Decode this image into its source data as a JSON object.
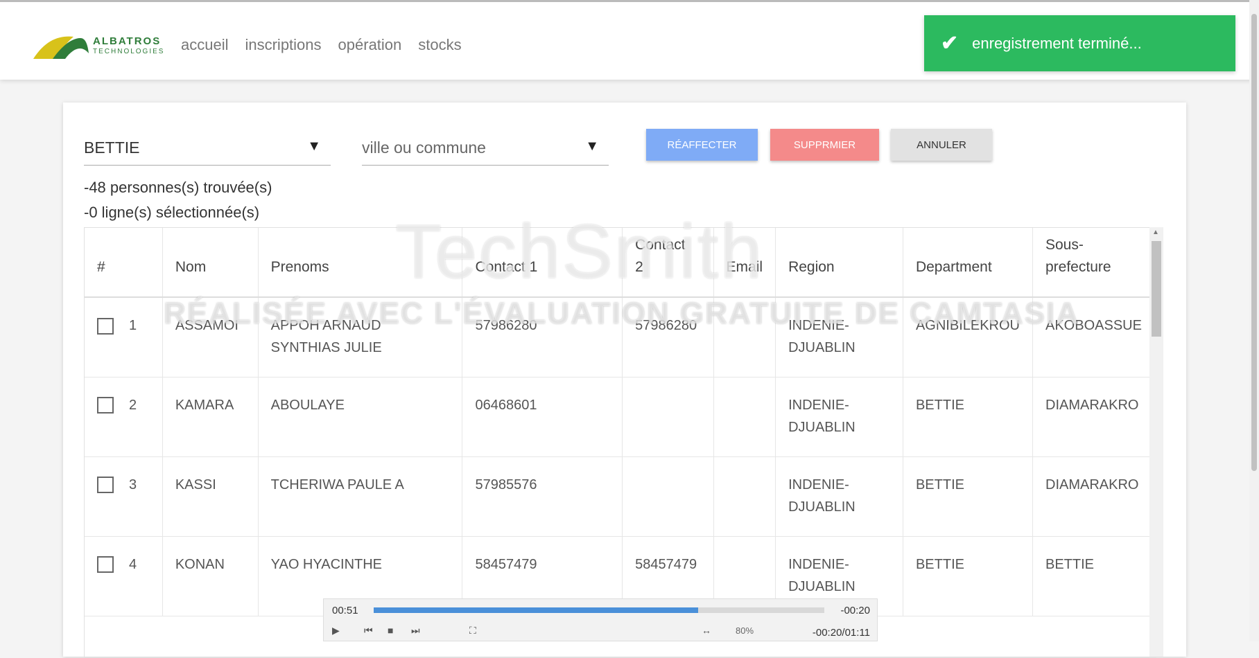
{
  "header": {
    "brand_line1": "ALBATROS",
    "brand_line2": "TECHNOLOGIES",
    "nav": [
      "accueil",
      "inscriptions",
      "opération",
      "stocks"
    ]
  },
  "toast": {
    "message": "enregistrement terminé..."
  },
  "filters": {
    "department_value": "BETTIE",
    "commune_placeholder": "ville ou commune"
  },
  "buttons": {
    "reassign": "RÉAFFECTER",
    "delete": "SUPPRMIER",
    "cancel": "ANNULER"
  },
  "info": {
    "found": "-48 personnes(s) trouvée(s)",
    "selected": "-0 ligne(s) sélectionnée(s)"
  },
  "table": {
    "headers": [
      "#",
      "Nom",
      "Prenoms",
      "Contact 1",
      "Contact 2",
      "Email",
      "Region",
      "Department",
      "Sous-prefecture"
    ],
    "rows": [
      {
        "n": "1",
        "nom": "ASSAMOI",
        "prenoms": "APPOH ARNAUD SYNTHIAS JULIE",
        "c1": "57986280",
        "c2": "57986280",
        "email": "",
        "region": "INDENIE-DJUABLIN",
        "dept": "AGNIBILEKROU",
        "sp": "AKOBOASSUE"
      },
      {
        "n": "2",
        "nom": "KAMARA",
        "prenoms": "ABOULAYE",
        "c1": "06468601",
        "c2": "",
        "email": "",
        "region": "INDENIE-DJUABLIN",
        "dept": "BETTIE",
        "sp": "DIAMARAKRO"
      },
      {
        "n": "3",
        "nom": "KASSI",
        "prenoms": "TCHERIWA PAULE A",
        "c1": "57985576",
        "c2": "",
        "email": "",
        "region": "INDENIE-DJUABLIN",
        "dept": "BETTIE",
        "sp": "DIAMARAKRO"
      },
      {
        "n": "4",
        "nom": "KONAN",
        "prenoms": "YAO HYACINTHE",
        "c1": "58457479",
        "c2": "58457479",
        "email": "",
        "region": "INDENIE-DJUABLIN",
        "dept": "BETTIE",
        "sp": "BETTIE"
      }
    ]
  },
  "watermark": {
    "line1": "TechSmith",
    "line2": "RÉALISÉE AVEC L'ÉVALUATION GRATUITE DE CAMTASIA"
  },
  "player": {
    "current": "00:51",
    "remaining": "-00:20",
    "volume": "80%",
    "time_total": "-00:20/01:11",
    "progress": 0.72
  },
  "colors": {
    "toast": "#2cba5f",
    "reassign": "#7fabf6",
    "delete": "#f48a8a",
    "cancel": "#e2e2e2"
  }
}
